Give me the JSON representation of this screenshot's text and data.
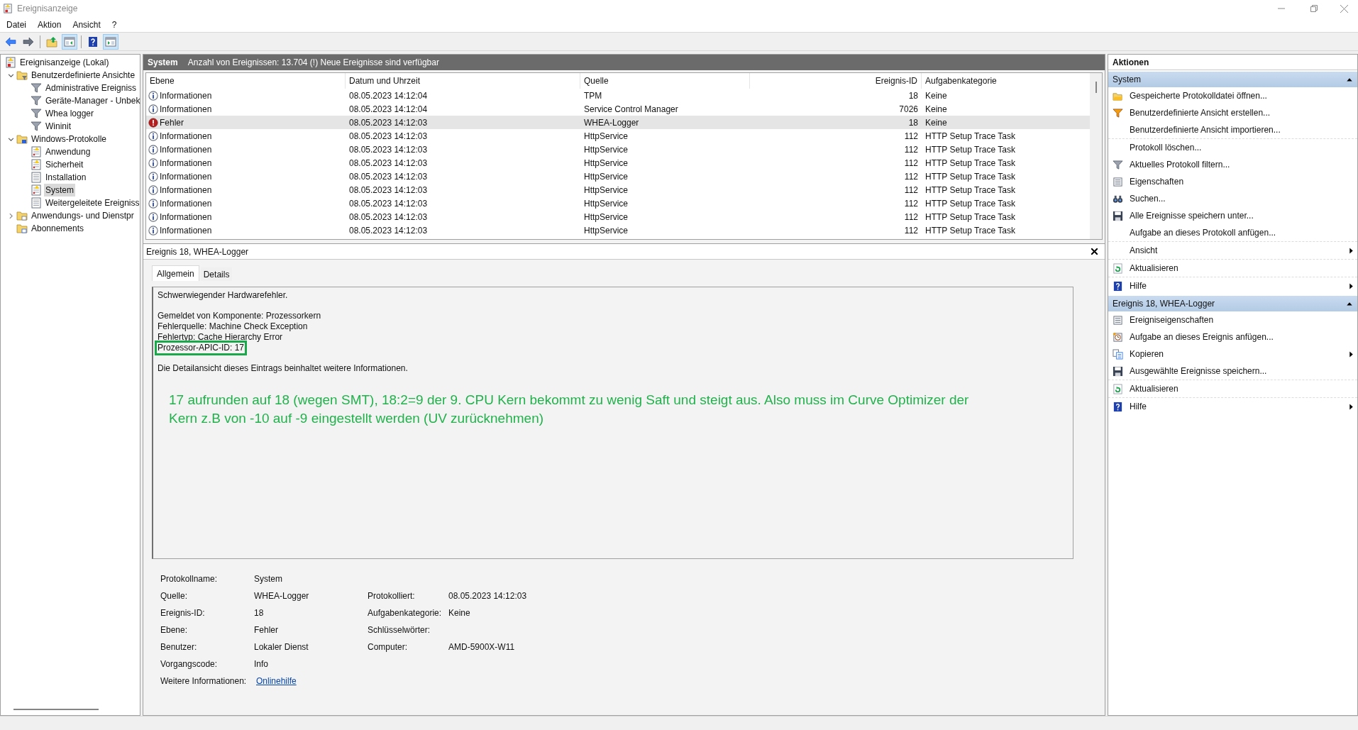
{
  "window": {
    "title": "Ereignisanzeige"
  },
  "menu": [
    "Datei",
    "Aktion",
    "Ansicht",
    "?"
  ],
  "toolbar": [
    {
      "kind": "back",
      "pressed": false
    },
    {
      "kind": "forward",
      "pressed": false
    },
    {
      "kind": "sep"
    },
    {
      "kind": "up",
      "pressed": false
    },
    {
      "kind": "tree-pane",
      "pressed": true
    },
    {
      "kind": "sep"
    },
    {
      "kind": "help",
      "pressed": false
    },
    {
      "kind": "action-pane",
      "pressed": true
    }
  ],
  "tree": [
    {
      "label": "Ereignisanzeige (Lokal)",
      "kind": "root",
      "selected": false,
      "children": [
        {
          "label": "Benutzerdefinierte Ansichte",
          "kind": "folder-filter",
          "selected": false,
          "expanded": true,
          "children": [
            {
              "label": "Administrative Ereigniss",
              "kind": "filter",
              "selected": false
            },
            {
              "label": "Geräte-Manager - Unbek",
              "kind": "filter",
              "selected": false
            },
            {
              "label": "Whea logger",
              "kind": "filter",
              "selected": false
            },
            {
              "label": "Wininit",
              "kind": "filter",
              "selected": false
            }
          ]
        },
        {
          "label": "Windows-Protokolle",
          "kind": "folder-pc",
          "selected": false,
          "expanded": true,
          "children": [
            {
              "label": "Anwendung",
              "kind": "log",
              "selected": false
            },
            {
              "label": "Sicherheit",
              "kind": "log",
              "selected": false
            },
            {
              "label": "Installation",
              "kind": "log-plain",
              "selected": false
            },
            {
              "label": "System",
              "kind": "log",
              "selected": true
            },
            {
              "label": "Weitergeleitete Ereigniss",
              "kind": "log-plain",
              "selected": false
            }
          ]
        },
        {
          "label": "Anwendungs- und Dienstpr",
          "kind": "folder-app",
          "selected": false,
          "expanded": false
        },
        {
          "label": "Abonnements",
          "kind": "folder-sub",
          "selected": false
        }
      ]
    }
  ],
  "log_header": {
    "name": "System",
    "info": "Anzahl von Ereignissen: 13.704 (!) Neue Ereignisse sind verfügbar"
  },
  "table": {
    "columns": [
      "Ebene",
      "Datum und Uhrzeit",
      "Quelle",
      "Ereignis-ID",
      "Aufgabenkategorie"
    ],
    "rows": [
      {
        "kind": "info",
        "level": "Informationen",
        "date": "08.05.2023 14:12:04",
        "source": "TPM",
        "id": "18",
        "category": "Keine",
        "selected": false
      },
      {
        "kind": "info",
        "level": "Informationen",
        "date": "08.05.2023 14:12:04",
        "source": "Service Control Manager",
        "id": "7026",
        "category": "Keine",
        "selected": false
      },
      {
        "kind": "error",
        "level": "Fehler",
        "date": "08.05.2023 14:12:03",
        "source": "WHEA-Logger",
        "id": "18",
        "category": "Keine",
        "selected": true
      },
      {
        "kind": "info",
        "level": "Informationen",
        "date": "08.05.2023 14:12:03",
        "source": "HttpService",
        "id": "112",
        "category": "HTTP Setup Trace Task",
        "selected": false
      },
      {
        "kind": "info",
        "level": "Informationen",
        "date": "08.05.2023 14:12:03",
        "source": "HttpService",
        "id": "112",
        "category": "HTTP Setup Trace Task",
        "selected": false
      },
      {
        "kind": "info",
        "level": "Informationen",
        "date": "08.05.2023 14:12:03",
        "source": "HttpService",
        "id": "112",
        "category": "HTTP Setup Trace Task",
        "selected": false
      },
      {
        "kind": "info",
        "level": "Informationen",
        "date": "08.05.2023 14:12:03",
        "source": "HttpService",
        "id": "112",
        "category": "HTTP Setup Trace Task",
        "selected": false
      },
      {
        "kind": "info",
        "level": "Informationen",
        "date": "08.05.2023 14:12:03",
        "source": "HttpService",
        "id": "112",
        "category": "HTTP Setup Trace Task",
        "selected": false
      },
      {
        "kind": "info",
        "level": "Informationen",
        "date": "08.05.2023 14:12:03",
        "source": "HttpService",
        "id": "112",
        "category": "HTTP Setup Trace Task",
        "selected": false
      },
      {
        "kind": "info",
        "level": "Informationen",
        "date": "08.05.2023 14:12:03",
        "source": "HttpService",
        "id": "112",
        "category": "HTTP Setup Trace Task",
        "selected": false
      },
      {
        "kind": "info",
        "level": "Informationen",
        "date": "08.05.2023 14:12:03",
        "source": "HttpService",
        "id": "112",
        "category": "HTTP Setup Trace Task",
        "selected": false
      }
    ]
  },
  "detail": {
    "title": "Ereignis 18, WHEA-Logger",
    "tabs": [
      {
        "label": "Allgemein",
        "selected": true
      },
      {
        "label": "Details",
        "selected": false
      }
    ],
    "description": [
      [
        {
          "text": "Schwerwiegender Hardwarefehler.",
          "highlighted": false
        }
      ],
      [
        {
          "text": "Gemeldet von Komponente: Prozessorkern",
          "highlighted": false
        },
        {
          "text": "Fehlerquelle: Machine Check Exception",
          "highlighted": false
        },
        {
          "text": "Fehlertyp: Cache Hierarchy Error",
          "highlighted": false
        },
        {
          "text": "Prozessor-APIC-ID: 17",
          "highlighted": true
        }
      ],
      [
        {
          "text": "Die Detailansicht dieses Eintrags beinhaltet weitere Informationen.",
          "highlighted": false
        }
      ]
    ],
    "annotation": [
      "17 aufrunden auf 18 (wegen SMT), 18:2=9 der 9. CPU Kern bekommt zu wenig Saft und steigt aus. Also muss im Curve Optimizer der",
      "Kern z.B von -10 auf -9 eingestellt werden (UV zurücknehmen)"
    ],
    "properties": [
      [
        {
          "label": "Protokollname:",
          "value": "System"
        }
      ],
      [
        {
          "label": "Quelle:",
          "value": "WHEA-Logger"
        },
        {
          "label": "Protokolliert:",
          "value": "08.05.2023 14:12:03"
        }
      ],
      [
        {
          "label": "Ereignis-ID:",
          "value": "18"
        },
        {
          "label": "Aufgabenkategorie:",
          "value": "Keine"
        }
      ],
      [
        {
          "label": "Ebene:",
          "value": "Fehler"
        },
        {
          "label": "Schlüsselwörter:"
        }
      ],
      [
        {
          "label": "Benutzer:",
          "value": "Lokaler Dienst"
        },
        {
          "label": "Computer:",
          "value": "AMD-5900X-W11"
        }
      ],
      [
        {
          "label": "Vorgangscode:",
          "value": "Info"
        }
      ],
      [
        {
          "label": "Weitere Informationen:",
          "value": "Onlinehilfe",
          "link": true
        }
      ]
    ]
  },
  "actions": {
    "title": "Aktionen",
    "sections": [
      {
        "title": "System",
        "expanded": true,
        "groups": [
          [
            {
              "kind": "open",
              "label": "Gespeicherte Protokolldatei öffnen...",
              "submenu": false
            },
            {
              "kind": "filter-gold",
              "label": "Benutzerdefinierte Ansicht erstellen...",
              "submenu": false
            },
            {
              "kind": "none",
              "label": "Benutzerdefinierte Ansicht importieren...",
              "submenu": false
            }
          ],
          [
            {
              "kind": "none",
              "label": "Protokoll löschen...",
              "submenu": false
            },
            {
              "kind": "filter",
              "label": "Aktuelles Protokoll filtern...",
              "submenu": false
            },
            {
              "kind": "properties",
              "label": "Eigenschaften",
              "submenu": false
            },
            {
              "kind": "find",
              "label": "Suchen...",
              "submenu": false
            },
            {
              "kind": "save",
              "label": "Alle Ereignisse speichern unter...",
              "submenu": false
            },
            {
              "kind": "none",
              "label": "Aufgabe an dieses Protokoll anfügen...",
              "submenu": false
            }
          ],
          [
            {
              "kind": "none",
              "label": "Ansicht",
              "submenu": true
            }
          ],
          [
            {
              "kind": "refresh",
              "label": "Aktualisieren",
              "submenu": false
            }
          ],
          [
            {
              "kind": "help",
              "label": "Hilfe",
              "submenu": true
            }
          ]
        ]
      },
      {
        "title": "Ereignis 18, WHEA-Logger",
        "expanded": true,
        "groups": [
          [
            {
              "kind": "properties",
              "label": "Ereigniseigenschaften",
              "submenu": false
            },
            {
              "kind": "task",
              "label": "Aufgabe an dieses Ereignis anfügen...",
              "submenu": false
            },
            {
              "kind": "copy",
              "label": "Kopieren",
              "submenu": true
            },
            {
              "kind": "save",
              "label": "Ausgewählte Ereignisse speichern...",
              "submenu": false
            }
          ],
          [
            {
              "kind": "refresh",
              "label": "Aktualisieren",
              "submenu": false
            }
          ],
          [
            {
              "kind": "help",
              "label": "Hilfe",
              "submenu": true
            }
          ]
        ]
      }
    ]
  }
}
